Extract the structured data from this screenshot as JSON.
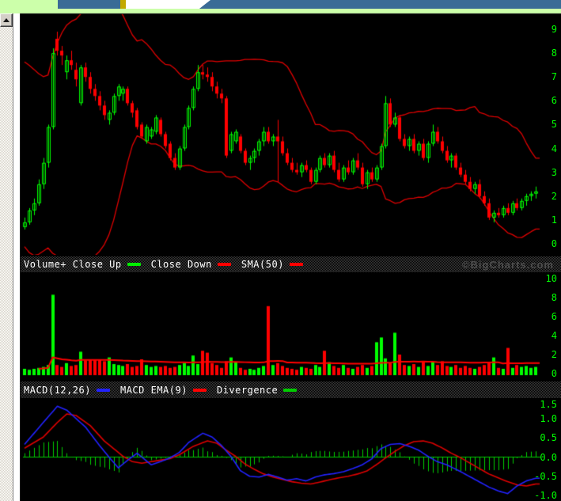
{
  "watermark": "©BigCharts.com",
  "legend_volume": {
    "items": [
      {
        "label": "Volume+ Close Up",
        "color": "#00ee00"
      },
      {
        "label": "Close Down",
        "color": "#ff0000"
      },
      {
        "label": "SMA(50)",
        "color": "#ff0000"
      }
    ]
  },
  "legend_macd": {
    "items": [
      {
        "label": "MACD(12,26)",
        "color": "#2222ff"
      },
      {
        "label": "MACD EMA(9)",
        "color": "#ff0000"
      },
      {
        "label": "Divergence",
        "color": "#00cc00"
      }
    ]
  },
  "colors": {
    "up": "#00ff00",
    "down": "#ff0000",
    "band": "#e00000",
    "volume_sma": "#ff0000",
    "macd_line": "#2222ff",
    "signal_line": "#dd0000",
    "histogram": "#00cc00",
    "zero_line": "#00cc00",
    "axis_text": "#00ff00",
    "panel_bg": "#000000",
    "strip_green": "#ccffaa",
    "tab_blue": "#3a6b96",
    "tab_yellow": "#c3a900"
  },
  "chart_data": [
    {
      "type": "candlestick",
      "title": "Price with Bollinger Bands",
      "ylim": [
        -0.4,
        9.55
      ],
      "yticks": [
        [
          9,
          "9"
        ],
        [
          8,
          "8"
        ],
        [
          7,
          "7"
        ],
        [
          6,
          "6"
        ],
        [
          5,
          "5"
        ],
        [
          4,
          "4"
        ],
        [
          3,
          "3"
        ],
        [
          2,
          "2"
        ],
        [
          1,
          "1"
        ],
        [
          0,
          "0"
        ]
      ],
      "grid": false,
      "bollinger": {
        "period": 20,
        "k": 2
      },
      "pre_closes": [
        6.5,
        6.2,
        5.8,
        5.2,
        4.5,
        3.8,
        3.0,
        2.4,
        1.8,
        1.2
      ],
      "candles": [
        [
          0.7,
          1.1,
          0.6,
          0.9
        ],
        [
          0.9,
          1.5,
          0.8,
          1.4
        ],
        [
          1.4,
          1.9,
          1.2,
          1.7
        ],
        [
          1.7,
          2.7,
          1.6,
          2.5
        ],
        [
          2.5,
          3.6,
          2.3,
          3.4
        ],
        [
          3.4,
          5.0,
          3.2,
          4.9
        ],
        [
          4.9,
          8.2,
          4.8,
          8.0
        ],
        [
          8.6,
          8.9,
          7.9,
          8.1
        ],
        [
          8.1,
          8.3,
          7.5,
          7.9
        ],
        [
          7.2,
          7.9,
          6.9,
          7.7
        ],
        [
          7.7,
          8.1,
          7.3,
          7.5
        ],
        [
          7.3,
          7.6,
          6.6,
          6.9
        ],
        [
          5.9,
          7.5,
          5.8,
          7.4
        ],
        [
          7.4,
          7.6,
          6.8,
          7.0
        ],
        [
          7.0,
          7.2,
          6.3,
          6.5
        ],
        [
          6.5,
          6.7,
          6.0,
          6.2
        ],
        [
          6.2,
          6.4,
          5.6,
          5.8
        ],
        [
          5.8,
          6.0,
          5.2,
          5.4
        ],
        [
          5.2,
          5.6,
          5.0,
          5.5
        ],
        [
          5.5,
          6.3,
          5.4,
          6.2
        ],
        [
          6.2,
          6.7,
          6.0,
          6.6
        ],
        [
          6.3,
          6.6,
          6.0,
          6.5
        ],
        [
          6.5,
          6.6,
          5.8,
          5.9
        ],
        [
          5.9,
          6.0,
          5.3,
          5.5
        ],
        [
          5.6,
          5.7,
          4.8,
          4.9
        ],
        [
          5.0,
          5.1,
          4.4,
          4.5
        ],
        [
          4.3,
          5.0,
          4.2,
          4.9
        ],
        [
          4.5,
          4.9,
          4.4,
          4.8
        ],
        [
          4.7,
          5.4,
          4.6,
          5.3
        ],
        [
          5.2,
          5.3,
          4.5,
          4.6
        ],
        [
          4.6,
          4.7,
          4.0,
          4.1
        ],
        [
          4.2,
          4.3,
          3.5,
          3.6
        ],
        [
          3.6,
          3.8,
          3.1,
          3.2
        ],
        [
          3.2,
          4.1,
          3.1,
          4.0
        ],
        [
          4.0,
          5.0,
          3.9,
          4.9
        ],
        [
          4.9,
          5.8,
          4.8,
          5.7
        ],
        [
          5.7,
          6.6,
          5.6,
          6.5
        ],
        [
          6.5,
          7.5,
          6.4,
          7.2
        ],
        [
          7.2,
          7.5,
          6.9,
          7.1
        ],
        [
          7.1,
          7.4,
          6.8,
          7.0
        ],
        [
          7.0,
          7.2,
          6.4,
          6.6
        ],
        [
          6.6,
          6.8,
          6.1,
          6.3
        ],
        [
          6.3,
          6.5,
          5.9,
          6.1
        ],
        [
          6.1,
          6.2,
          3.6,
          3.7
        ],
        [
          3.9,
          4.7,
          3.8,
          4.6
        ],
        [
          4.3,
          4.8,
          4.2,
          4.7
        ],
        [
          4.5,
          4.6,
          3.8,
          3.9
        ],
        [
          3.9,
          4.0,
          3.3,
          3.4
        ],
        [
          3.4,
          3.7,
          3.1,
          3.6
        ],
        [
          3.6,
          4.0,
          3.4,
          3.9
        ],
        [
          3.9,
          4.4,
          3.7,
          4.3
        ],
        [
          4.3,
          4.9,
          4.1,
          4.7
        ],
        [
          4.7,
          4.9,
          4.2,
          4.3
        ],
        [
          4.3,
          4.6,
          4.1,
          4.5
        ],
        [
          4.5,
          5.2,
          2.6,
          4.3
        ],
        [
          4.3,
          4.5,
          3.7,
          3.8
        ],
        [
          3.8,
          4.0,
          3.3,
          3.4
        ],
        [
          3.4,
          3.6,
          3.0,
          3.1
        ],
        [
          3.1,
          3.4,
          2.9,
          3.0
        ],
        [
          3.0,
          3.4,
          2.8,
          3.3
        ],
        [
          3.3,
          3.5,
          3.0,
          3.1
        ],
        [
          3.1,
          3.2,
          2.5,
          2.6
        ],
        [
          2.6,
          3.2,
          2.5,
          3.1
        ],
        [
          3.1,
          3.7,
          3.0,
          3.6
        ],
        [
          3.6,
          3.8,
          3.2,
          3.3
        ],
        [
          3.3,
          3.8,
          3.2,
          3.7
        ],
        [
          3.7,
          3.9,
          3.0,
          3.1
        ],
        [
          3.1,
          3.4,
          2.6,
          2.7
        ],
        [
          2.7,
          3.3,
          2.6,
          3.2
        ],
        [
          3.2,
          3.5,
          2.9,
          3.0
        ],
        [
          3.0,
          3.6,
          2.9,
          3.5
        ],
        [
          3.5,
          3.8,
          3.1,
          3.2
        ],
        [
          3.2,
          3.4,
          2.4,
          2.5
        ],
        [
          2.5,
          3.1,
          2.3,
          3.0
        ],
        [
          3.0,
          3.2,
          2.6,
          2.7
        ],
        [
          2.7,
          3.3,
          2.6,
          3.2
        ],
        [
          3.2,
          4.2,
          3.1,
          4.1
        ],
        [
          4.1,
          6.2,
          4.0,
          5.9
        ],
        [
          5.9,
          6.1,
          4.9,
          5.0
        ],
        [
          5.0,
          5.5,
          4.9,
          5.3
        ],
        [
          5.3,
          5.4,
          4.3,
          4.4
        ],
        [
          4.4,
          4.6,
          4.0,
          4.1
        ],
        [
          4.1,
          4.5,
          3.9,
          4.4
        ],
        [
          4.4,
          4.6,
          3.8,
          3.9
        ],
        [
          3.9,
          4.3,
          3.7,
          4.2
        ],
        [
          4.2,
          4.4,
          3.5,
          3.6
        ],
        [
          3.6,
          4.3,
          3.4,
          4.2
        ],
        [
          4.2,
          5.0,
          4.1,
          4.7
        ],
        [
          4.7,
          4.9,
          4.2,
          4.3
        ],
        [
          4.3,
          4.5,
          3.8,
          3.9
        ],
        [
          3.9,
          4.1,
          3.4,
          3.5
        ],
        [
          3.5,
          3.8,
          3.2,
          3.7
        ],
        [
          3.7,
          3.8,
          3.1,
          3.2
        ],
        [
          3.2,
          3.4,
          2.8,
          2.9
        ],
        [
          2.9,
          3.1,
          2.5,
          2.6
        ],
        [
          2.6,
          2.8,
          2.2,
          2.3
        ],
        [
          2.3,
          2.6,
          2.1,
          2.5
        ],
        [
          2.5,
          2.7,
          1.9,
          2.0
        ],
        [
          2.0,
          2.2,
          1.6,
          1.7
        ],
        [
          1.7,
          1.9,
          1.0,
          1.1
        ],
        [
          1.1,
          1.4,
          0.9,
          1.3
        ],
        [
          1.3,
          1.5,
          1.1,
          1.2
        ],
        [
          1.2,
          1.6,
          1.1,
          1.5
        ],
        [
          1.5,
          1.7,
          1.2,
          1.3
        ],
        [
          1.3,
          1.8,
          1.2,
          1.7
        ],
        [
          1.7,
          1.9,
          1.4,
          1.5
        ],
        [
          1.5,
          1.9,
          1.4,
          1.8
        ],
        [
          1.8,
          2.1,
          1.6,
          2.0
        ],
        [
          2.0,
          2.2,
          1.8,
          2.1
        ],
        [
          2.1,
          2.4,
          1.9,
          2.2
        ]
      ]
    },
    {
      "type": "bar",
      "title": "Volume+",
      "ylim": [
        0,
        10.7
      ],
      "yticks": [
        [
          10,
          "10"
        ],
        [
          8,
          "8"
        ],
        [
          6,
          "6"
        ],
        [
          4,
          "4"
        ],
        [
          2,
          "2"
        ],
        [
          0,
          "0"
        ]
      ],
      "grid": false,
      "sma_window": 50,
      "values": [
        0.5,
        0.4,
        0.5,
        0.6,
        0.7,
        0.9,
        8.3,
        0.9,
        0.7,
        1.1,
        0.8,
        0.9,
        2.3,
        1.4,
        1.5,
        1.5,
        1.5,
        1.3,
        1.7,
        1.0,
        0.9,
        0.8,
        1.0,
        0.7,
        0.8,
        1.5,
        0.9,
        0.7,
        0.8,
        0.7,
        0.8,
        0.6,
        0.7,
        0.9,
        1.1,
        0.8,
        1.9,
        1.0,
        2.4,
        2.2,
        1.1,
        0.9,
        0.6,
        1.3,
        1.7,
        1.2,
        0.6,
        0.4,
        0.5,
        0.4,
        0.6,
        0.8,
        7.1,
        0.9,
        1.1,
        0.8,
        0.6,
        0.5,
        0.4,
        0.7,
        0.6,
        0.5,
        0.9,
        0.7,
        2.4,
        1.2,
        0.8,
        0.6,
        0.9,
        0.6,
        0.5,
        0.7,
        0.9,
        0.6,
        0.8,
        3.3,
        3.8,
        1.6,
        1.1,
        4.3,
        2.0,
        0.9,
        0.8,
        1.0,
        0.7,
        1.2,
        0.8,
        1.2,
        0.9,
        1.3,
        0.8,
        0.7,
        0.9,
        0.6,
        0.8,
        0.6,
        0.5,
        0.7,
        0.9,
        1.1,
        1.7,
        0.6,
        0.5,
        2.7,
        0.6,
        0.9,
        0.7,
        0.8,
        0.6,
        0.7
      ]
    },
    {
      "type": "line+histogram",
      "title": "MACD",
      "series_names": [
        "MACD(12,26)",
        "MACD EMA(9)",
        "Divergence"
      ],
      "ylim": [
        -1.15,
        1.51
      ],
      "yticks": [
        [
          1.5,
          "1.5"
        ],
        [
          1.0,
          "1.0"
        ],
        [
          0.5,
          "0.5"
        ],
        [
          0.0,
          "0.0"
        ],
        [
          -0.5,
          "-0.5"
        ],
        [
          -1.0,
          "-1.0"
        ]
      ],
      "grid": false,
      "macd_keys": [
        [
          0,
          0.33
        ],
        [
          4,
          0.9
        ],
        [
          7,
          1.32
        ],
        [
          9,
          1.22
        ],
        [
          13,
          0.78
        ],
        [
          16,
          0.3
        ],
        [
          18,
          0.0
        ],
        [
          20,
          -0.28
        ],
        [
          22,
          -0.08
        ],
        [
          24,
          0.1
        ],
        [
          25,
          0.0
        ],
        [
          27,
          -0.2
        ],
        [
          29,
          -0.12
        ],
        [
          31,
          -0.02
        ],
        [
          33,
          0.12
        ],
        [
          35,
          0.38
        ],
        [
          38,
          0.62
        ],
        [
          40,
          0.52
        ],
        [
          42,
          0.3
        ],
        [
          44,
          0.02
        ],
        [
          46,
          -0.35
        ],
        [
          48,
          -0.5
        ],
        [
          50,
          -0.52
        ],
        [
          52,
          -0.45
        ],
        [
          54,
          -0.52
        ],
        [
          56,
          -0.6
        ],
        [
          58,
          -0.56
        ],
        [
          60,
          -0.62
        ],
        [
          62,
          -0.52
        ],
        [
          64,
          -0.46
        ],
        [
          66,
          -0.43
        ],
        [
          68,
          -0.38
        ],
        [
          70,
          -0.3
        ],
        [
          72,
          -0.2
        ],
        [
          74,
          -0.05
        ],
        [
          76,
          0.22
        ],
        [
          78,
          0.33
        ],
        [
          80,
          0.35
        ],
        [
          82,
          0.28
        ],
        [
          84,
          0.18
        ],
        [
          86,
          0.02
        ],
        [
          88,
          -0.12
        ],
        [
          90,
          -0.2
        ],
        [
          93,
          -0.38
        ],
        [
          96,
          -0.58
        ],
        [
          99,
          -0.78
        ],
        [
          101,
          -0.88
        ],
        [
          103,
          -0.95
        ],
        [
          105,
          -0.75
        ],
        [
          107,
          -0.62
        ],
        [
          109,
          -0.55
        ]
      ],
      "signal_keys": [
        [
          0,
          0.23
        ],
        [
          4,
          0.52
        ],
        [
          7,
          0.9
        ],
        [
          9,
          1.12
        ],
        [
          11,
          1.08
        ],
        [
          14,
          0.82
        ],
        [
          17,
          0.42
        ],
        [
          21,
          0.02
        ],
        [
          23,
          -0.12
        ],
        [
          25,
          -0.16
        ],
        [
          28,
          -0.1
        ],
        [
          31,
          -0.04
        ],
        [
          33,
          0.06
        ],
        [
          36,
          0.28
        ],
        [
          39,
          0.42
        ],
        [
          41,
          0.36
        ],
        [
          43,
          0.18
        ],
        [
          45,
          0.02
        ],
        [
          47,
          -0.18
        ],
        [
          49,
          -0.32
        ],
        [
          51,
          -0.44
        ],
        [
          53,
          -0.52
        ],
        [
          55,
          -0.58
        ],
        [
          57,
          -0.64
        ],
        [
          59,
          -0.68
        ],
        [
          61,
          -0.7
        ],
        [
          63,
          -0.65
        ],
        [
          65,
          -0.59
        ],
        [
          67,
          -0.54
        ],
        [
          69,
          -0.5
        ],
        [
          71,
          -0.44
        ],
        [
          73,
          -0.36
        ],
        [
          75,
          -0.2
        ],
        [
          77,
          -0.02
        ],
        [
          79,
          0.15
        ],
        [
          81,
          0.3
        ],
        [
          83,
          0.4
        ],
        [
          85,
          0.42
        ],
        [
          87,
          0.36
        ],
        [
          89,
          0.24
        ],
        [
          91,
          0.1
        ],
        [
          93,
          -0.02
        ],
        [
          95,
          -0.16
        ],
        [
          97,
          -0.3
        ],
        [
          99,
          -0.44
        ],
        [
          101,
          -0.54
        ],
        [
          103,
          -0.64
        ],
        [
          105,
          -0.72
        ],
        [
          107,
          -0.75
        ],
        [
          109,
          -0.7
        ]
      ]
    }
  ]
}
